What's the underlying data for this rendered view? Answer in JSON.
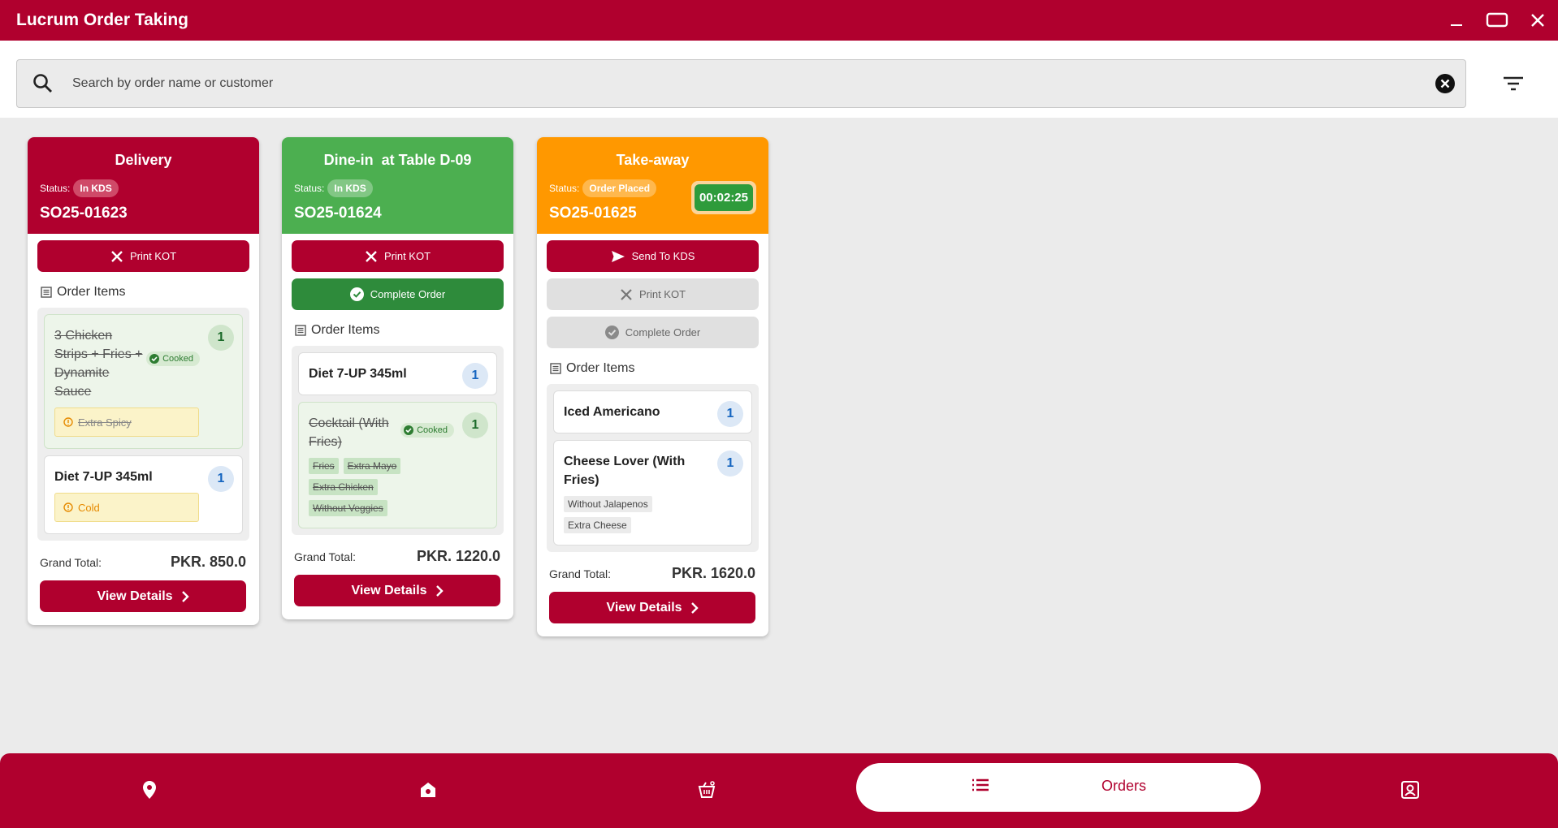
{
  "app": {
    "title": "Lucrum Order Taking"
  },
  "search": {
    "placeholder": "Search by order name or customer"
  },
  "common": {
    "status_label": "Status:",
    "order_items_label": "Order Items",
    "grand_total_label": "Grand Total:",
    "view_details_label": "View Details",
    "print_kot_label": "Print KOT",
    "complete_order_label": "Complete Order",
    "send_kds_label": "Send To KDS",
    "cooked_label": "Cooked"
  },
  "orders": [
    {
      "type": "Delivery",
      "status": "In KDS",
      "order_no": "SO25-01623",
      "header_color": "#b0002e",
      "items": [
        {
          "name": "3 Chicken Strips + Fries + Dynamite Sauce",
          "qty": "1",
          "cooked": true,
          "note": "Extra Spicy"
        },
        {
          "name": "Diet 7-UP 345ml",
          "qty": "1",
          "cooked": false,
          "note": "Cold"
        }
      ],
      "grand_total": "PKR. 850.0"
    },
    {
      "type": "Dine-in  at Table D-09",
      "status": "In KDS",
      "order_no": "SO25-01624",
      "header_color": "#4caf50",
      "items": [
        {
          "name": "Diet 7-UP 345ml",
          "qty": "1",
          "cooked": false
        },
        {
          "name": "Cocktail (With Fries)",
          "qty": "1",
          "cooked": true,
          "tags": [
            "Fries",
            "Extra Mayo",
            "Extra Chicken",
            "Without Veggies"
          ]
        }
      ],
      "grand_total": "PKR. 1220.0"
    },
    {
      "type": "Take-away",
      "status": "Order Placed",
      "order_no": "SO25-01625",
      "timer": "00:02:25",
      "header_color": "#ff9800",
      "items": [
        {
          "name": "Iced Americano",
          "qty": "1",
          "cooked": false
        },
        {
          "name": "Cheese Lover (With Fries)",
          "qty": "1",
          "cooked": false,
          "tags": [
            "Without Jalapenos",
            "Extra Cheese"
          ]
        }
      ],
      "grand_total": "PKR. 1620.0"
    }
  ],
  "nav": {
    "items": [
      {
        "icon": "location-pin-icon"
      },
      {
        "icon": "home-icon"
      },
      {
        "icon": "basket-icon"
      },
      {
        "icon": "list-icon",
        "label": "Orders",
        "active": true
      },
      {
        "icon": "account-icon"
      }
    ]
  },
  "colors": {
    "brand": "#b0002e",
    "dine_in": "#4caf50",
    "take_away": "#ff9800",
    "complete": "#2e8b3b"
  }
}
